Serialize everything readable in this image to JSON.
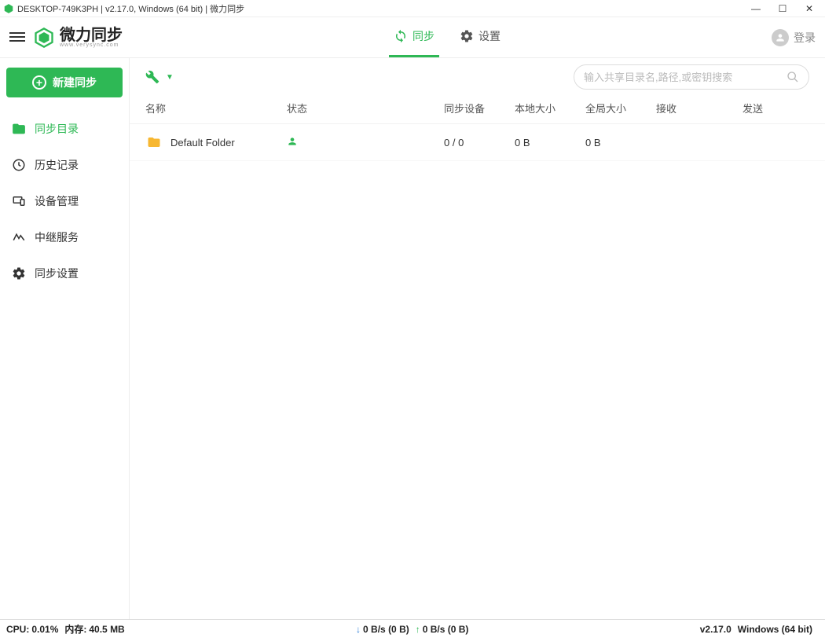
{
  "window": {
    "title": "DESKTOP-749K3PH | v2.17.0, Windows (64 bit) | 微力同步"
  },
  "header": {
    "brand_cn": "微力同步",
    "brand_url": "www.verysync.com",
    "tabs": {
      "sync": "同步",
      "settings": "设置"
    },
    "login": "登录"
  },
  "sidebar": {
    "new_sync": "新建同步",
    "items": [
      {
        "label": "同步目录"
      },
      {
        "label": "历史记录"
      },
      {
        "label": "设备管理"
      },
      {
        "label": "中继服务"
      },
      {
        "label": "同步设置"
      }
    ]
  },
  "search": {
    "placeholder": "输入共享目录名,路径,或密钥搜索"
  },
  "columns": {
    "name": "名称",
    "status": "状态",
    "devices": "同步设备",
    "local": "本地大小",
    "global": "全局大小",
    "recv": "接收",
    "send": "发送"
  },
  "rows": [
    {
      "name": "Default Folder",
      "devices": "0 / 0",
      "local": "0 B",
      "global": "0 B"
    }
  ],
  "status": {
    "cpu_label": "CPU:",
    "cpu": "0.01%",
    "mem_label": "内存:",
    "mem": "40.5 MB",
    "down": "0 B/s (0 B)",
    "up": "0 B/s (0 B)",
    "version": "v2.17.0",
    "os": "Windows (64 bit)"
  }
}
